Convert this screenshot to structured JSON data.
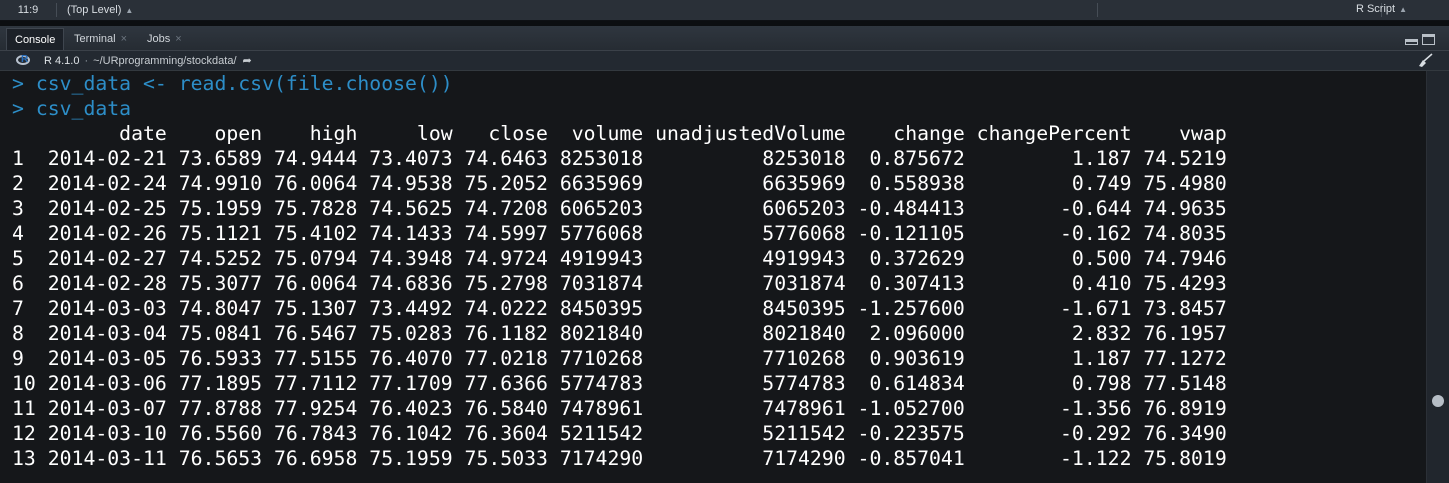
{
  "statusbar": {
    "position": "11:9",
    "scope": "(Top Level)",
    "file_type": "R Script"
  },
  "pane": {
    "tabs": [
      {
        "label": "Console",
        "active": true
      },
      {
        "label": "Terminal",
        "active": false
      },
      {
        "label": "Jobs",
        "active": false
      }
    ]
  },
  "console_toolbar": {
    "r_version": "R 4.1.0",
    "separator": "·",
    "working_dir": "~/URprogramming/stockdata/"
  },
  "console": {
    "commands": [
      "> csv_data <- read.csv(file.choose())",
      "> csv_data"
    ],
    "columns": [
      "date",
      "open",
      "high",
      "low",
      "close",
      "volume",
      "unadjustedVolume",
      "change",
      "changePercent",
      "vwap"
    ],
    "rows": [
      [
        "1",
        "2014-02-21",
        "73.6589",
        "74.9444",
        "73.4073",
        "74.6463",
        "8253018",
        "8253018",
        "0.875672",
        "1.187",
        "74.5219"
      ],
      [
        "2",
        "2014-02-24",
        "74.9910",
        "76.0064",
        "74.9538",
        "75.2052",
        "6635969",
        "6635969",
        "0.558938",
        "0.749",
        "75.4980"
      ],
      [
        "3",
        "2014-02-25",
        "75.1959",
        "75.7828",
        "74.5625",
        "74.7208",
        "6065203",
        "6065203",
        "-0.484413",
        "-0.644",
        "74.9635"
      ],
      [
        "4",
        "2014-02-26",
        "75.1121",
        "75.4102",
        "74.1433",
        "74.5997",
        "5776068",
        "5776068",
        "-0.121105",
        "-0.162",
        "74.8035"
      ],
      [
        "5",
        "2014-02-27",
        "74.5252",
        "75.0794",
        "74.3948",
        "74.9724",
        "4919943",
        "4919943",
        "0.372629",
        "0.500",
        "74.7946"
      ],
      [
        "6",
        "2014-02-28",
        "75.3077",
        "76.0064",
        "74.6836",
        "75.2798",
        "7031874",
        "7031874",
        "0.307413",
        "0.410",
        "75.4293"
      ],
      [
        "7",
        "2014-03-03",
        "74.8047",
        "75.1307",
        "73.4492",
        "74.0222",
        "8450395",
        "8450395",
        "-1.257600",
        "-1.671",
        "73.8457"
      ],
      [
        "8",
        "2014-03-04",
        "75.0841",
        "76.5467",
        "75.0283",
        "76.1182",
        "8021840",
        "8021840",
        "2.096000",
        "2.832",
        "76.1957"
      ],
      [
        "9",
        "2014-03-05",
        "76.5933",
        "77.5155",
        "76.4070",
        "77.0218",
        "7710268",
        "7710268",
        "0.903619",
        "1.187",
        "77.1272"
      ],
      [
        "10",
        "2014-03-06",
        "77.1895",
        "77.7112",
        "77.1709",
        "77.6366",
        "5774783",
        "5774783",
        "0.614834",
        "0.798",
        "77.5148"
      ],
      [
        "11",
        "2014-03-07",
        "77.8788",
        "77.9254",
        "76.4023",
        "76.5840",
        "7478961",
        "7478961",
        "-1.052700",
        "-1.356",
        "76.8919"
      ],
      [
        "12",
        "2014-03-10",
        "76.5560",
        "76.7843",
        "76.1042",
        "76.3604",
        "5211542",
        "5211542",
        "-0.223575",
        "-0.292",
        "76.3490"
      ],
      [
        "13",
        "2014-03-11",
        "76.5653",
        "76.6958",
        "75.1959",
        "75.5033",
        "7174290",
        "7174290",
        "-0.857041",
        "-1.122",
        "75.8019"
      ]
    ]
  },
  "colors": {
    "console_bg": "#15171a",
    "command": "#2d8ec8",
    "output": "#ffffff"
  }
}
